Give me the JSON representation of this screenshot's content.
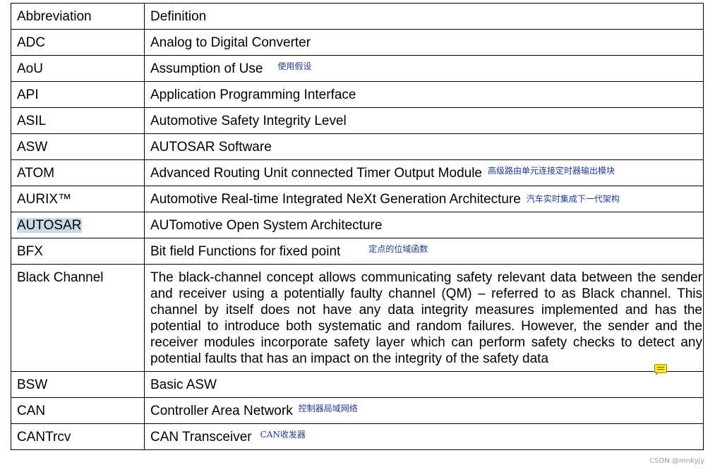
{
  "table": {
    "header": {
      "abbreviation": "Abbreviation",
      "definition": "Definition"
    },
    "rows": [
      {
        "abbr": "ADC",
        "def": "Analog to Digital Converter",
        "note": ""
      },
      {
        "abbr": "AoU",
        "def": "Assumption of Use",
        "note": "使用假设"
      },
      {
        "abbr": "API",
        "def": "Application Programming Interface",
        "note": ""
      },
      {
        "abbr": "ASIL",
        "def": "Automotive Safety Integrity Level",
        "note": ""
      },
      {
        "abbr": "ASW",
        "def": "AUTOSAR Software",
        "note": ""
      },
      {
        "abbr": "ATOM",
        "def": "Advanced Routing Unit connected Timer Output Module",
        "note": "高级路由单元连接定时器输出模块"
      },
      {
        "abbr": "AURIX™",
        "def": "Automotive Real-time Integrated NeXt Generation Architecture",
        "note": "汽车实时集成下一代架构"
      },
      {
        "abbr": "AUTOSAR",
        "def": "AUTomotive Open System Architecture",
        "note": ""
      },
      {
        "abbr": "BFX",
        "def": "Bit field Functions for fixed point",
        "note": "定点的位域函数"
      },
      {
        "abbr": "Black Channel",
        "def": "The black-channel concept allows communicating safety relevant data between the sender and receiver using a potentially faulty channel (QM) – referred to as Black channel. This channel by itself does not have any data integrity measures implemented and has the potential to introduce both systematic and random failures. However, the sender and the receiver modules incorporate safety layer which can perform safety checks to detect any potential faults that has an impact on the integrity of the safety data",
        "note": ""
      },
      {
        "abbr": "BSW",
        "def": "Basic ASW",
        "note": ""
      },
      {
        "abbr": "CAN",
        "def": "Controller Area Network",
        "note": "控制器局域网络"
      },
      {
        "abbr": "CANTrcv",
        "def": "CAN Transceiver",
        "note": "CAN收发器"
      }
    ]
  },
  "watermark": "CSDN @mnkyjy"
}
